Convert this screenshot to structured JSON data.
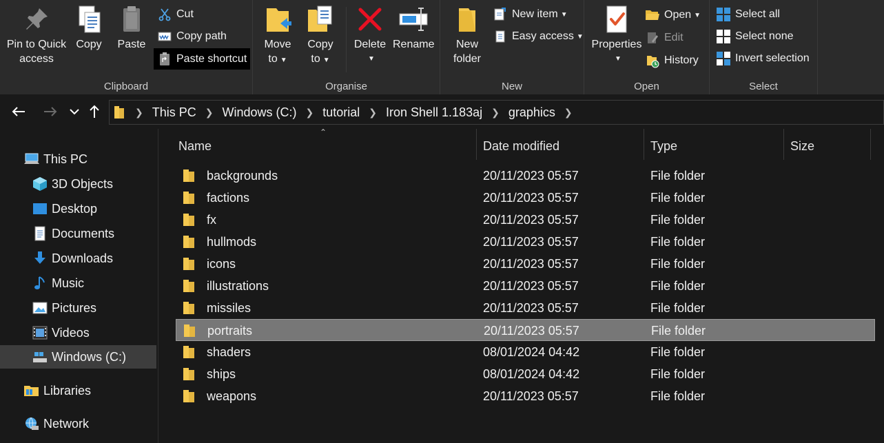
{
  "ribbon": {
    "clipboard": {
      "label": "Clipboard",
      "pin_label_1": "Pin to Quick",
      "pin_label_2": "access",
      "copy_label": "Copy",
      "paste_label": "Paste",
      "cut_label": "Cut",
      "copy_path_label": "Copy path",
      "paste_shortcut_label": "Paste shortcut"
    },
    "organise": {
      "label": "Organise",
      "move_to_1": "Move",
      "move_to_2": "to",
      "copy_to_1": "Copy",
      "copy_to_2": "to",
      "delete_label": "Delete",
      "rename_label": "Rename"
    },
    "new": {
      "label": "New",
      "new_folder_1": "New",
      "new_folder_2": "folder",
      "new_item_label": "New item",
      "easy_access_label": "Easy access"
    },
    "open": {
      "label": "Open",
      "properties_label": "Properties",
      "open_label": "Open",
      "edit_label": "Edit",
      "history_label": "History"
    },
    "select": {
      "label": "Select",
      "select_all_label": "Select all",
      "select_none_label": "Select none",
      "invert_label": "Invert selection"
    }
  },
  "address": {
    "crumbs": [
      "This PC",
      "Windows (C:)",
      "tutorial",
      "Iron Shell 1.183aj",
      "graphics"
    ]
  },
  "navpane": {
    "items": [
      {
        "label": "This PC",
        "icon": "pc-icon"
      },
      {
        "label": "3D Objects",
        "icon": "cube-icon"
      },
      {
        "label": "Desktop",
        "icon": "desktop-icon"
      },
      {
        "label": "Documents",
        "icon": "document-icon"
      },
      {
        "label": "Downloads",
        "icon": "download-icon"
      },
      {
        "label": "Music",
        "icon": "music-icon"
      },
      {
        "label": "Pictures",
        "icon": "pictures-icon"
      },
      {
        "label": "Videos",
        "icon": "videos-icon"
      },
      {
        "label": "Windows (C:)",
        "icon": "drive-icon"
      },
      {
        "label": "Libraries",
        "icon": "libraries-icon"
      },
      {
        "label": "Network",
        "icon": "network-icon"
      }
    ],
    "selected": "Windows (C:)"
  },
  "columns": {
    "name": "Name",
    "date": "Date modified",
    "type": "Type",
    "size": "Size"
  },
  "files": [
    {
      "name": "backgrounds",
      "date": "20/11/2023 05:57",
      "type": "File folder"
    },
    {
      "name": "factions",
      "date": "20/11/2023 05:57",
      "type": "File folder"
    },
    {
      "name": "fx",
      "date": "20/11/2023 05:57",
      "type": "File folder"
    },
    {
      "name": "hullmods",
      "date": "20/11/2023 05:57",
      "type": "File folder"
    },
    {
      "name": "icons",
      "date": "20/11/2023 05:57",
      "type": "File folder"
    },
    {
      "name": "illustrations",
      "date": "20/11/2023 05:57",
      "type": "File folder"
    },
    {
      "name": "missiles",
      "date": "20/11/2023 05:57",
      "type": "File folder"
    },
    {
      "name": "portraits",
      "date": "20/11/2023 05:57",
      "type": "File folder"
    },
    {
      "name": "shaders",
      "date": "08/01/2024 04:42",
      "type": "File folder"
    },
    {
      "name": "ships",
      "date": "08/01/2024 04:42",
      "type": "File folder"
    },
    {
      "name": "weapons",
      "date": "20/11/2023 05:57",
      "type": "File folder"
    }
  ],
  "selected_file": "portraits",
  "colors": {
    "background": "#191919",
    "ribbon": "#2b2b2b",
    "folder": "#f4c84f",
    "selection": "#777777",
    "delete_red": "#e81123",
    "accent_blue": "#3a96dd"
  }
}
